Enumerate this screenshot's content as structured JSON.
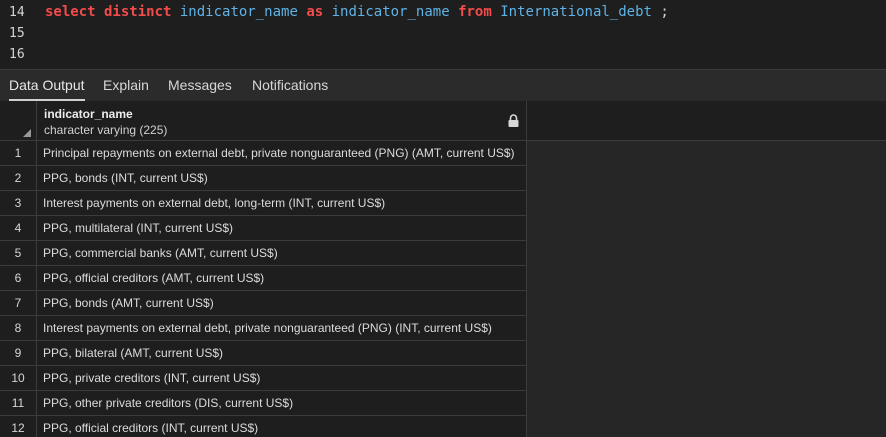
{
  "editor": {
    "lines": [
      {
        "num": "14",
        "tokens": [
          {
            "t": "select distinct",
            "c": "kw"
          },
          {
            "t": " ",
            "c": "pn"
          },
          {
            "t": "indicator_name",
            "c": "id"
          },
          {
            "t": " ",
            "c": "pn"
          },
          {
            "t": "as",
            "c": "kw"
          },
          {
            "t": " ",
            "c": "pn"
          },
          {
            "t": "indicator_name",
            "c": "id"
          },
          {
            "t": " ",
            "c": "pn"
          },
          {
            "t": "from",
            "c": "kw"
          },
          {
            "t": " ",
            "c": "pn"
          },
          {
            "t": "International_debt",
            "c": "id"
          },
          {
            "t": " ;",
            "c": "pn"
          }
        ]
      },
      {
        "num": "15",
        "tokens": []
      },
      {
        "num": "16",
        "tokens": []
      }
    ]
  },
  "tabs": [
    {
      "label": "Data Output",
      "active": true
    },
    {
      "label": "Explain",
      "active": false
    },
    {
      "label": "Messages",
      "active": false
    },
    {
      "label": "Notifications",
      "active": false
    }
  ],
  "grid": {
    "column": {
      "name": "indicator_name",
      "type": "character varying (225)",
      "icon": "lock-icon"
    },
    "rows": [
      {
        "n": "1",
        "value": "Principal repayments on external debt, private nonguaranteed (PNG) (AMT, current US$)"
      },
      {
        "n": "2",
        "value": "PPG, bonds (INT, current US$)"
      },
      {
        "n": "3",
        "value": "Interest payments on external debt, long-term (INT, current US$)"
      },
      {
        "n": "4",
        "value": "PPG, multilateral (INT, current US$)"
      },
      {
        "n": "5",
        "value": "PPG, commercial banks (AMT, current US$)"
      },
      {
        "n": "6",
        "value": "PPG, official creditors (AMT, current US$)"
      },
      {
        "n": "7",
        "value": "PPG, bonds (AMT, current US$)"
      },
      {
        "n": "8",
        "value": "Interest payments on external debt, private nonguaranteed (PNG) (INT, current US$)"
      },
      {
        "n": "9",
        "value": "PPG, bilateral (AMT, current US$)"
      },
      {
        "n": "10",
        "value": "PPG, private creditors (INT, current US$)"
      },
      {
        "n": "11",
        "value": "PPG, other private creditors (DIS, current US$)"
      },
      {
        "n": "12",
        "value": "PPG, official creditors (INT, current US$)"
      }
    ]
  }
}
